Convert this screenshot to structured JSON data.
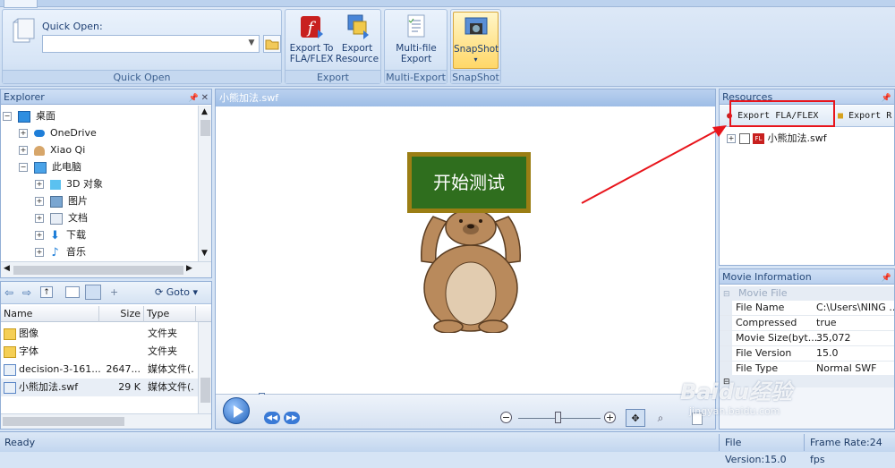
{
  "ribbon": {
    "quick_open": {
      "label": "Quick Open:",
      "value": "",
      "group_label": "Quick Open"
    },
    "export_group": {
      "label": "Export",
      "buttons": [
        {
          "line1": "Export To",
          "line2": "FLA/FLEX",
          "icon": "flash-export-icon"
        },
        {
          "line1": "Export",
          "line2": "Resource",
          "icon": "resource-export-icon"
        }
      ]
    },
    "multi_export_group": {
      "label": "Multi-Export",
      "button_line1": "Multi-file",
      "button_line2": "Export"
    },
    "snapshot_group": {
      "label": "SnapShot",
      "button_label": "SnapShot"
    }
  },
  "explorer": {
    "title": "Explorer",
    "tree": [
      {
        "label": "桌面",
        "indent": 0,
        "icon": "desktop-icon",
        "expanded": true
      },
      {
        "label": "OneDrive",
        "indent": 1,
        "icon": "cloud-icon"
      },
      {
        "label": "Xiao Qi",
        "indent": 1,
        "icon": "user-icon"
      },
      {
        "label": "此电脑",
        "indent": 1,
        "icon": "computer-icon",
        "expanded": true
      },
      {
        "label": "3D 对象",
        "indent": 2,
        "icon": "cube-icon"
      },
      {
        "label": "图片",
        "indent": 2,
        "icon": "picture-icon"
      },
      {
        "label": "文档",
        "indent": 2,
        "icon": "document-icon"
      },
      {
        "label": "下载",
        "indent": 2,
        "icon": "download-icon"
      },
      {
        "label": "音乐",
        "indent": 2,
        "icon": "music-icon"
      }
    ],
    "toolbar": {
      "goto_label": "Goto"
    },
    "file_list": {
      "columns": [
        "Name",
        "Size",
        "Type"
      ],
      "rows": [
        {
          "name": "图像",
          "size": "",
          "type": "文件夹",
          "icon": "folder-icon"
        },
        {
          "name": "字体",
          "size": "",
          "type": "文件夹",
          "icon": "folder-icon"
        },
        {
          "name": "decision-3-161...",
          "size": "2647...",
          "type": "媒体文件(.",
          "icon": "swf-file-icon"
        },
        {
          "name": "小熊加法.swf",
          "size": "29 K",
          "type": "媒体文件(.",
          "icon": "swf-file-icon"
        }
      ]
    }
  },
  "viewer": {
    "tab_title": "小熊加法.swf",
    "sign_text": "开始测试",
    "time_dots": ". . ."
  },
  "resources": {
    "title": "Resources",
    "export_fla_label": "Export FLA/FLEX",
    "export_res_label": "Export R",
    "tree_item": "小熊加法.swf"
  },
  "movie_info": {
    "title": "Movie Information",
    "section_label": "Movie File",
    "rows": [
      {
        "key": "File Name",
        "value": "C:\\Users\\NING ..."
      },
      {
        "key": "Compressed",
        "value": "true"
      },
      {
        "key": "Movie Size(byt...",
        "value": "35,072"
      },
      {
        "key": "File Version",
        "value": "15.0"
      },
      {
        "key": "File Type",
        "value": "Normal SWF"
      }
    ]
  },
  "status": {
    "ready": "Ready",
    "file_version": "File Version:15.0",
    "frame_rate": "Frame Rate:24 fps"
  },
  "watermark": {
    "text": "Baidu经验",
    "url": "jingyan.baidu.com"
  },
  "colors": {
    "annotation_red": "#e8141b",
    "sign_green": "#2f6e1e",
    "sign_border": "#9b7e14",
    "bear_brown": "#b98a5c"
  }
}
